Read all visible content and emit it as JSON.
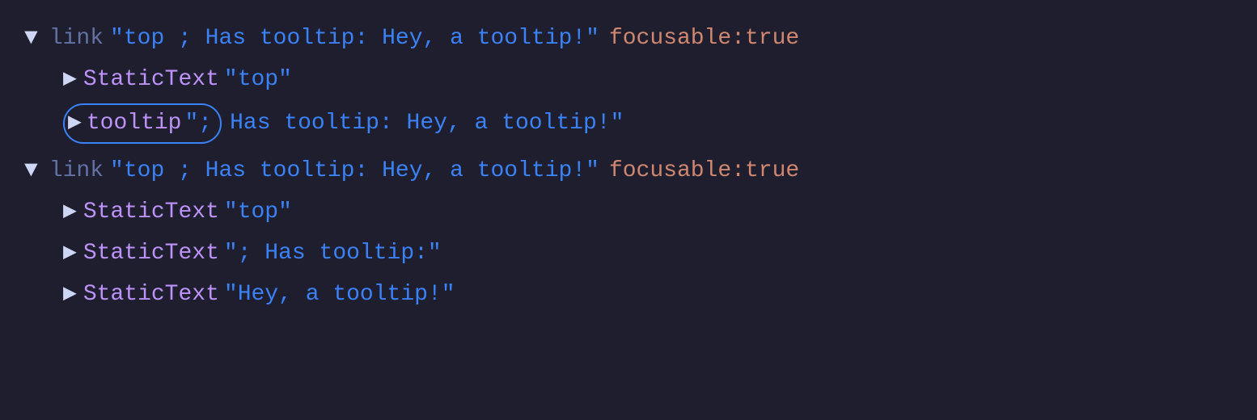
{
  "tree": {
    "block1": {
      "row1": {
        "arrow": "▼",
        "type": "link",
        "value": "\"top ; Has tooltip: Hey, a tooltip!\"",
        "prop": "focusable:",
        "propValue": "true"
      },
      "row2": {
        "arrow": "▶",
        "type": "StaticText",
        "value": "\"top\""
      },
      "row3": {
        "arrow": "▶",
        "type": "tooltip",
        "typeExtra": "\";",
        "value": "Has tooltip: Hey, a tooltip!\""
      }
    },
    "block2": {
      "row1": {
        "arrow": "▼",
        "type": "link",
        "value": "\"top ; Has tooltip: Hey, a tooltip!\"",
        "prop": "focusable:",
        "propValue": "true"
      },
      "row2": {
        "arrow": "▶",
        "type": "StaticText",
        "value": "\"top\""
      },
      "row3": {
        "arrow": "▶",
        "type": "StaticText",
        "value": "\"; Has tooltip:\""
      },
      "row4": {
        "arrow": "▶",
        "type": "StaticText",
        "value": "\"Hey, a tooltip!\""
      }
    }
  }
}
